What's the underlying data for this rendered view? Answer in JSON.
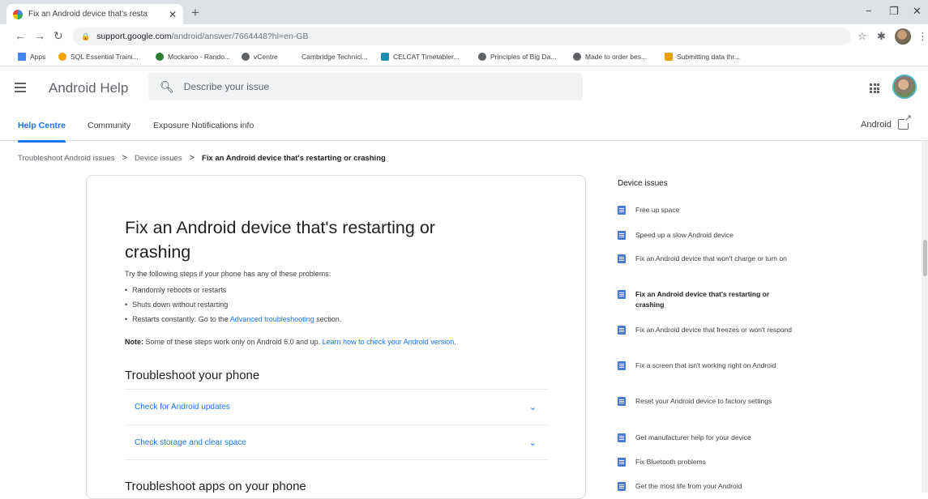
{
  "browser": {
    "tab_title": "Fix an Android device that's resta",
    "tab_close": "✕",
    "new_tab": "+",
    "window_controls": [
      "−",
      "❐",
      "✕"
    ],
    "url_host": "support.google.com",
    "url_path": "/android/answer/7664448?hl=en-GB",
    "bookmarks": [
      "Apps",
      "SQL Essential Traini...",
      "Mockaroo - Rando...",
      "vCentre",
      "Cambridge Technici...",
      "CELCAT Timetabler...",
      "Principles of Big Da...",
      "Made to order bes...",
      "Submitting data thr..."
    ]
  },
  "header": {
    "product": "Android Help",
    "search_placeholder": "Describe your issue"
  },
  "tabs": [
    {
      "label": "Help Centre",
      "active": true
    },
    {
      "label": "Community",
      "active": false
    },
    {
      "label": "Exposure Notifications info",
      "active": false
    }
  ],
  "android_link": "Android",
  "breadcrumb": [
    "Troubleshoot Android issues",
    "Device issues",
    "Fix an Android device that's restarting or crashing"
  ],
  "article": {
    "title": "Fix an Android device that's restarting or crashing",
    "intro": "Try the following steps if your phone has any of these problems:",
    "bullet1": "Randomly reboots or restarts",
    "bullet2": "Shuts down without restarting",
    "bullet3_pre": "Restarts constantly: Go to the ",
    "bullet3_link": "Advanced troubleshooting",
    "bullet3_post": " section.",
    "note_label": "Note:",
    "note_text": " Some of these steps work only on Android 6.0 and up. ",
    "note_link": "Learn how to check your Android version.",
    "section1": "Troubleshoot your phone",
    "accordion": [
      "Check for Android updates",
      "Check storage and clear space"
    ],
    "section2": "Troubleshoot apps on your phone"
  },
  "sidebar": {
    "title": "Device issues",
    "items": [
      "Free up space",
      "Speed up a slow Android device",
      "Fix an Android device that won't charge or turn on",
      "Fix an Android device that's restarting or crashing",
      "Fix an Android device that freezes or won't respond",
      "Fix a screen that isn't working right on Android",
      "Reset your Android device to factory settings",
      "Get manufacturer help for your device",
      "Fix Bluetooth problems",
      "Get the most life from your Android"
    ],
    "current_index": 3
  },
  "colors": {
    "accent": "#1a73e8",
    "tabstrip": "#dee1e6"
  }
}
